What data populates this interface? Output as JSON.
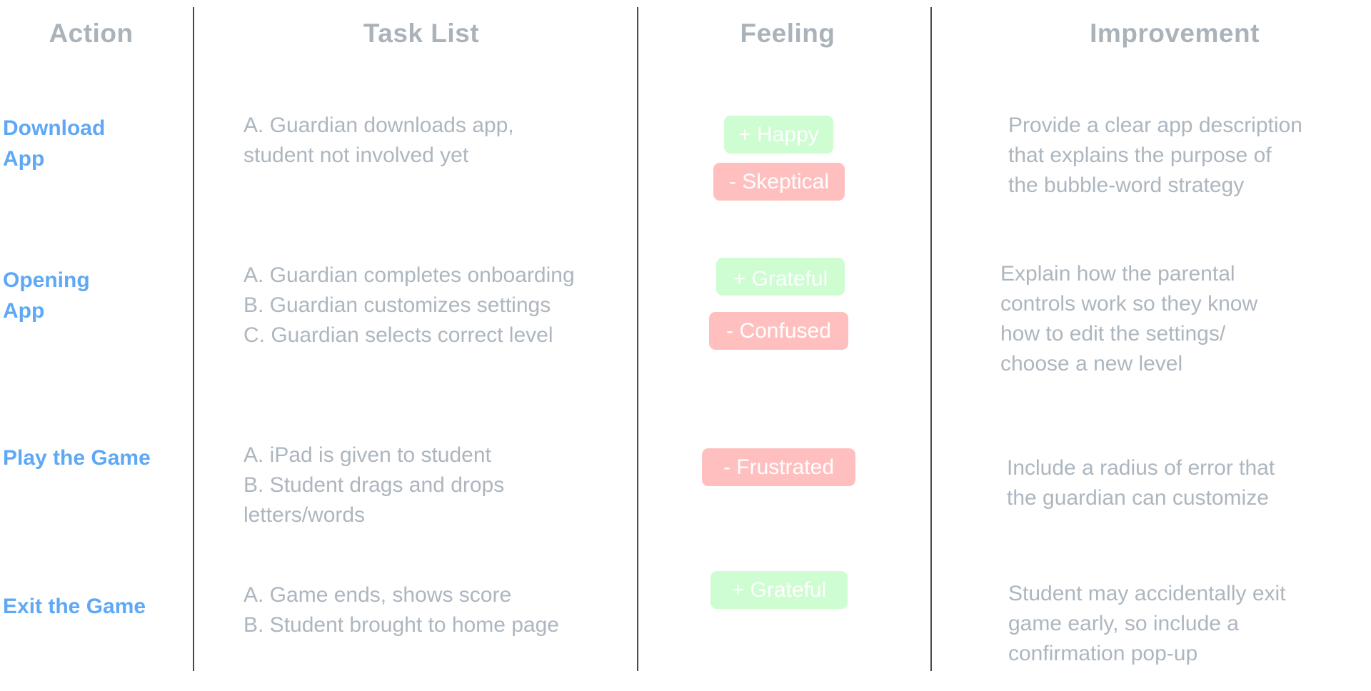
{
  "colors": {
    "header_text": "#aab2ba",
    "action_text": "#5fa8f5",
    "body_text": "#adb6bf",
    "positive_badge": "#cdfdd1",
    "negative_badge": "#ffbfbf",
    "divider": "#4a4a4a"
  },
  "headers": {
    "action": "Action",
    "task_list": "Task List",
    "feeling": "Feeling",
    "improvement": "Improvement"
  },
  "rows": [
    {
      "action": "Download\nApp",
      "tasks": [
        "A. Guardian downloads app,",
        "student not involved yet"
      ],
      "feelings": [
        {
          "label": "+ Happy",
          "sentiment": "positive"
        },
        {
          "label": "- Skeptical",
          "sentiment": "negative"
        }
      ],
      "improvement": [
        "Provide a clear app description",
        "that explains the purpose of",
        "the bubble-word strategy"
      ]
    },
    {
      "action": "Opening\nApp",
      "tasks": [
        "A. Guardian completes onboarding",
        "B. Guardian customizes settings",
        "C. Guardian selects correct level"
      ],
      "feelings": [
        {
          "label": "+ Grateful",
          "sentiment": "positive"
        },
        {
          "label": "- Confused",
          "sentiment": "negative"
        }
      ],
      "improvement": [
        "Explain how the parental",
        "controls work so they know",
        "how to edit the settings/",
        "choose a new level"
      ]
    },
    {
      "action": "Play the Game",
      "tasks": [
        "A. iPad is given to student",
        "B. Student drags and drops",
        "letters/words"
      ],
      "feelings": [
        {
          "label": "- Frustrated",
          "sentiment": "negative"
        }
      ],
      "improvement": [
        "Include a radius of error that",
        "the guardian can customize"
      ]
    },
    {
      "action": "Exit the Game",
      "tasks": [
        "A. Game ends, shows score",
        "B. Student brought to home page"
      ],
      "feelings": [
        {
          "label": "+ Grateful",
          "sentiment": "positive"
        }
      ],
      "improvement": [
        "Student may accidentally exit",
        "game early, so include a",
        "confirmation pop-up"
      ]
    }
  ]
}
